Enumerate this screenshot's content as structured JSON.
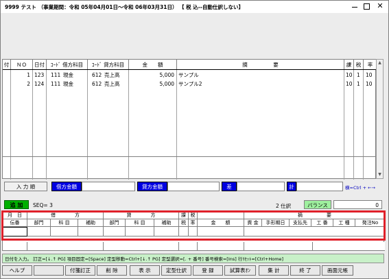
{
  "title": "9999 テスト （事業期間：令和 05年04月01日～令和 06年03月31日） 【 税 込--自動仕訳しない】",
  "grid": {
    "headers": [
      "付",
      "ＮＯ",
      "日付",
      "ｺｰﾄﾞ 借方科目",
      "ｺｰﾄﾞ 貸方科目",
      "金　　額",
      "摘　　　　　要",
      "課",
      "税",
      "率"
    ],
    "rows": [
      {
        "no": "1",
        "date": "123",
        "dcode": "111",
        "dacct": "現金",
        "ccode": "612",
        "cacct": "売上高",
        "amount": "5,000",
        "memo": "サンプル",
        "ka": "10",
        "zei": "1",
        "rate": "10"
      },
      {
        "no": "2",
        "date": "124",
        "dcode": "111",
        "dacct": "現金",
        "ccode": "612",
        "cacct": "売上高",
        "amount": "5,000",
        "memo": "サンプル2",
        "ka": "10",
        "zei": "1",
        "rate": "10"
      }
    ]
  },
  "entry_bar": {
    "input_order": "入 力 順",
    "debit_total": "借方金額",
    "credit_total": "貸方金額",
    "diff": "差",
    "total": "計",
    "hint": "横=Ctrl + ←→"
  },
  "add": {
    "label": "追 加",
    "seq": "SEQ= 3",
    "count": "2 仕訳",
    "balance": "バランス",
    "balance_value": "0"
  },
  "lower": {
    "top_headers": [
      "月　日",
      "借　　　　方",
      "貸　　　　方",
      "課",
      "税",
      "",
      "摘　　　　　要"
    ],
    "sub_headers": [
      "伝番",
      "部門",
      "科 目",
      "補助",
      "部門",
      "科 目",
      "補助",
      "税",
      "率",
      "金　　額",
      "資 金",
      "手形期日",
      "支払先",
      "工 番",
      "工 種",
      "発注No"
    ],
    "sub_header_parts": [
      "課",
      "税"
    ],
    "kazei_label": "課税"
  },
  "status": "日付を入力。 訂正=[↓.↑ PG] 項目固定=[Space] 定型移動=Ctrl+[↓.↑ PG] 定型選択=[. + 番号] 番号検索=[Ins] 行ﾘｾｯﾄ=[Ctrl+Home]",
  "fkeys": [
    "ヘルプ",
    "",
    "付箋訂正",
    "削 除",
    "表 示",
    "定型仕訳",
    "登 録",
    "試算表ｵﾝ",
    "集 計",
    "終 了",
    "画面元帳"
  ]
}
